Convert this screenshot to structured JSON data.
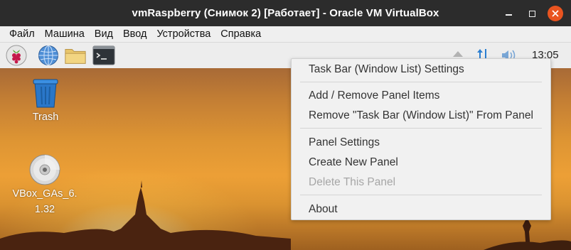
{
  "window": {
    "title": "vmRaspberry (Снимок 2) [Работает] - Oracle VM VirtualBox",
    "controls": [
      "minimize-icon",
      "maximize-icon",
      "close-icon"
    ],
    "close_color": "#e95420"
  },
  "menubar": {
    "items": [
      "Файл",
      "Машина",
      "Вид",
      "Ввод",
      "Устройства",
      "Справка"
    ]
  },
  "panel": {
    "launchers": [
      "raspberry-menu-icon",
      "web-browser-icon",
      "file-manager-icon",
      "terminal-icon"
    ],
    "tray": [
      "eject-icon",
      "network-updown-icon",
      "volume-icon"
    ],
    "clock": "13:05"
  },
  "desktop": {
    "icons": [
      {
        "label": "Trash",
        "icon": "trash-icon"
      },
      {
        "label": "VBox_GAs_6.1.32",
        "icon": "cd-disc-icon"
      }
    ]
  },
  "context_menu": {
    "items": [
      {
        "label": "Task Bar (Window List) Settings",
        "enabled": true
      },
      {
        "label": "Add / Remove Panel Items",
        "enabled": true
      },
      {
        "label": "Remove \"Task Bar (Window List)\" From Panel",
        "enabled": true
      },
      {
        "label": "Panel Settings",
        "enabled": true
      },
      {
        "label": "Create New Panel",
        "enabled": true
      },
      {
        "label": "Delete This Panel",
        "enabled": false
      },
      {
        "label": "About",
        "enabled": true
      }
    ]
  }
}
